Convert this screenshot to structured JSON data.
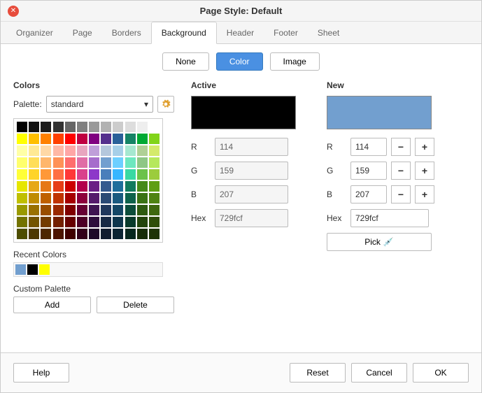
{
  "title": "Page Style: Default",
  "tabs": [
    "Organizer",
    "Page",
    "Borders",
    "Background",
    "Header",
    "Footer",
    "Sheet"
  ],
  "active_tab": "Background",
  "modes": {
    "none": "None",
    "color": "Color",
    "image": "Image"
  },
  "colors_section": {
    "title": "Colors",
    "palette_label": "Palette:",
    "palette_value": "standard",
    "recent_label": "Recent Colors",
    "custom_label": "Custom Palette",
    "add_btn": "Add",
    "delete_btn": "Delete"
  },
  "active_section": {
    "title": "Active",
    "color": "#000000",
    "r": "114",
    "g": "159",
    "b": "207",
    "hex": "729fcf"
  },
  "new_section": {
    "title": "New",
    "color": "#729fcf",
    "r": "114",
    "g": "159",
    "b": "207",
    "hex": "729fcf",
    "pick": "Pick"
  },
  "labels": {
    "r": "R",
    "g": "G",
    "b": "B",
    "hex": "Hex"
  },
  "recent_colors": [
    "#729fcf",
    "#000000",
    "#ffff00"
  ],
  "footer": {
    "help": "Help",
    "reset": "Reset",
    "cancel": "Cancel",
    "ok": "OK"
  },
  "swatches": [
    "#000000",
    "#111111",
    "#1c1c1c",
    "#333333",
    "#666666",
    "#808080",
    "#999999",
    "#b2b2b2",
    "#cccccc",
    "#dddddd",
    "#eeeeee",
    "#ffffff",
    "#ffff00",
    "#ffbf00",
    "#ff8000",
    "#ff4000",
    "#ff0000",
    "#bf0041",
    "#800080",
    "#55308d",
    "#2a6099",
    "#158466",
    "#00a933",
    "#81d41a",
    "#ffffa6",
    "#ffe994",
    "#ffd8a6",
    "#ffb8a6",
    "#ffa6a6",
    "#e8a6bf",
    "#bf9ed9",
    "#b4c7dc",
    "#a6cfe8",
    "#a6e8d0",
    "#afd095",
    "#d4ea6b",
    "#ffff6d",
    "#ffde59",
    "#ffb66c",
    "#ff9257",
    "#ff6d6d",
    "#e06da6",
    "#a66dcc",
    "#729fcf",
    "#6dcfff",
    "#6de8bf",
    "#8ec785",
    "#b6e85c",
    "#ffff38",
    "#ffd428",
    "#ff9838",
    "#ff7043",
    "#ff3838",
    "#d9418c",
    "#8d38c9",
    "#4a7ebb",
    "#38b6ff",
    "#38d9a3",
    "#6cc24a",
    "#9ccc3c",
    "#e6e600",
    "#e6a817",
    "#e67817",
    "#e63e17",
    "#cc0000",
    "#b3004b",
    "#6b2085",
    "#355a8e",
    "#1f6e9c",
    "#127a5e",
    "#468a1a",
    "#5e9e14",
    "#bfbf00",
    "#bf8c00",
    "#bf6000",
    "#bf3300",
    "#a60000",
    "#8c003c",
    "#551a6b",
    "#2a4a75",
    "#1a5a80",
    "#0e634c",
    "#3a7315",
    "#4e8312",
    "#999900",
    "#997000",
    "#994d00",
    "#992900",
    "#800000",
    "#660033",
    "#3f1452",
    "#20385c",
    "#144766",
    "#0b4d3b",
    "#2d5a10",
    "#3e680e",
    "#737300",
    "#735400",
    "#733a00",
    "#731f00",
    "#660000",
    "#4d0026",
    "#2e0e3d",
    "#182a45",
    "#0f364d",
    "#083a2c",
    "#22440c",
    "#2f4e0a",
    "#4d4d00",
    "#4d3800",
    "#4d2700",
    "#4d1500",
    "#400000",
    "#33001a",
    "#1f0a29",
    "#101c2e",
    "#0a2433",
    "#05271e",
    "#172d08",
    "#1f3407"
  ]
}
